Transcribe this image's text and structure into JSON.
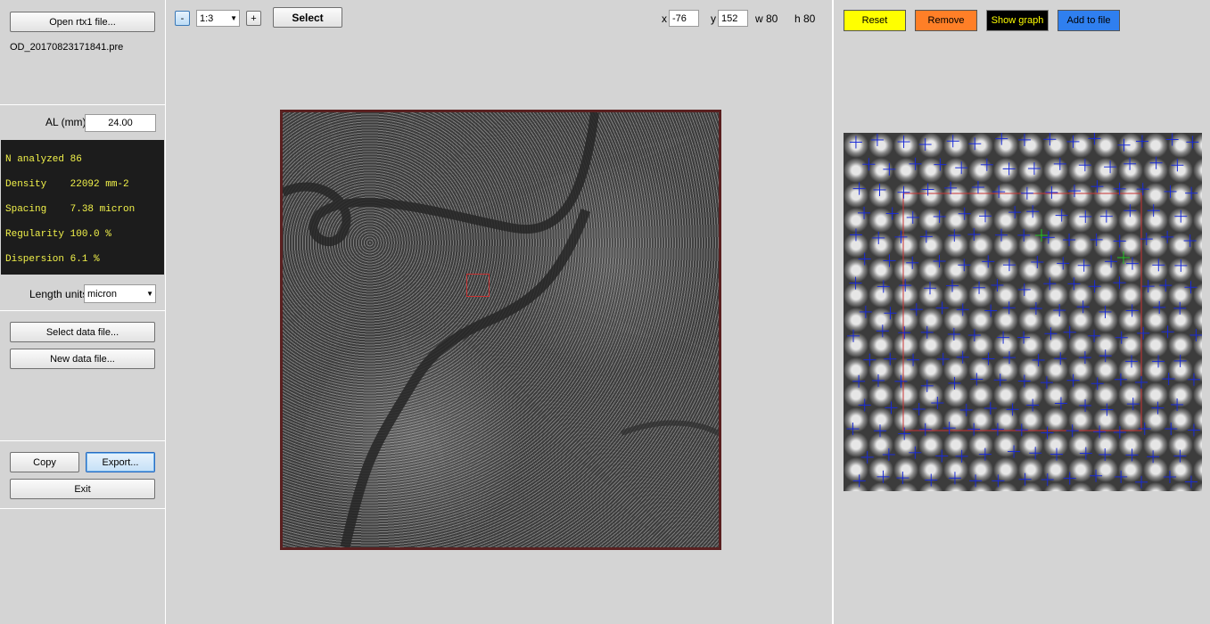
{
  "left_panel": {
    "open_button": "Open rtx1 file...",
    "filename": "OD_20170823171841.pre",
    "al_label": "AL (mm)",
    "al_value": "24.00",
    "stats": [
      {
        "label": "N analyzed",
        "value": "86"
      },
      {
        "label": "Density",
        "value": "22092 mm-2"
      },
      {
        "label": "Spacing",
        "value": "7.38 micron"
      },
      {
        "label": "Regularity",
        "value": "100.0 %"
      },
      {
        "label": "Dispersion",
        "value": "6.1 %"
      }
    ],
    "length_units_label": "Length units",
    "length_units_value": "micron",
    "select_data_button": "Select data file...",
    "new_data_button": "New data file...",
    "copy_button": "Copy",
    "export_button": "Export...",
    "exit_button": "Exit"
  },
  "center_panel": {
    "zoom_minus": "-",
    "zoom_value": "1:3",
    "zoom_plus": "+",
    "select_button": "Select",
    "x_label": "x",
    "x_value": "-76",
    "y_label": "y",
    "y_value": "152",
    "w_label": "w 80",
    "h_label": "h 80"
  },
  "right_panel": {
    "reset_button": "Reset",
    "remove_button": "Remove",
    "show_graph_button": "Show graph",
    "add_to_file_button": "Add to file"
  },
  "colors": {
    "reset": "#ffff00",
    "remove": "#ff7f27",
    "show_graph_bg": "#000000",
    "show_graph_text": "#ffff00",
    "add_to_file": "#2f7fef",
    "marker_blue": "#1a2bd6",
    "marker_green": "#22c322",
    "roi_red": "#c83232"
  }
}
